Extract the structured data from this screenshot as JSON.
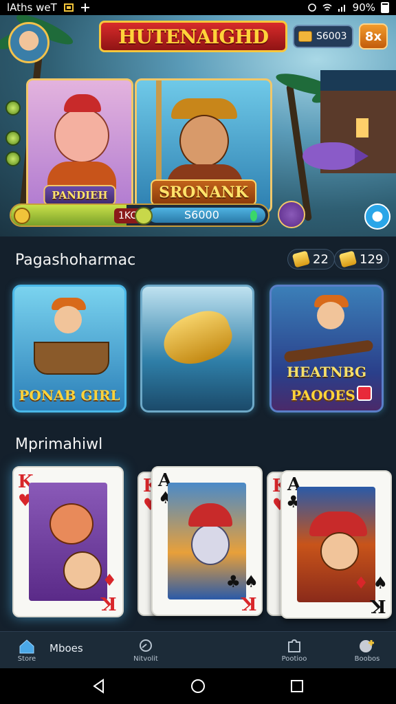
{
  "status_bar": {
    "left_text": "lAths weT",
    "battery": "90%"
  },
  "header": {
    "logo_text": "HUTENAIGHD",
    "coins": "S6003",
    "close_label": "8x"
  },
  "hero": {
    "left_card_label": "PANDIEH",
    "right_card_label": "SRONANK",
    "progress_mid": "1KC",
    "progress_amount": "S6000",
    "progress_level": 0.45
  },
  "section1": {
    "title": "Pagashoharmac",
    "stat_a": "22",
    "stat_b": "129",
    "tiles": [
      {
        "label": "PONAB GIRL"
      },
      {
        "label": ""
      },
      {
        "label_top": "HEATNBG",
        "label": "PAOOES"
      }
    ]
  },
  "section2": {
    "title": "Mprimahiwl",
    "cards": [
      {
        "rank": "K",
        "rank_bottom": "K"
      },
      {
        "rank_back": "K",
        "rank": "A",
        "rank_bottom": "K"
      },
      {
        "rank_back": "K",
        "rank": "A",
        "rank_bottom": "K"
      }
    ]
  },
  "bottom_nav": {
    "inline_label": "Mboes",
    "items": [
      {
        "label": "Store",
        "icon": "home-icon"
      },
      {
        "label": "Nitvolit",
        "icon": "search-icon"
      },
      {
        "label": "Pootioo",
        "icon": "puzzle-icon"
      },
      {
        "label": "Boobos",
        "icon": "profile-icon"
      }
    ]
  },
  "colors": {
    "accent_gold": "#ffd33a",
    "banner_red": "#d82b2b",
    "tile_border": "#4ab8e8"
  }
}
